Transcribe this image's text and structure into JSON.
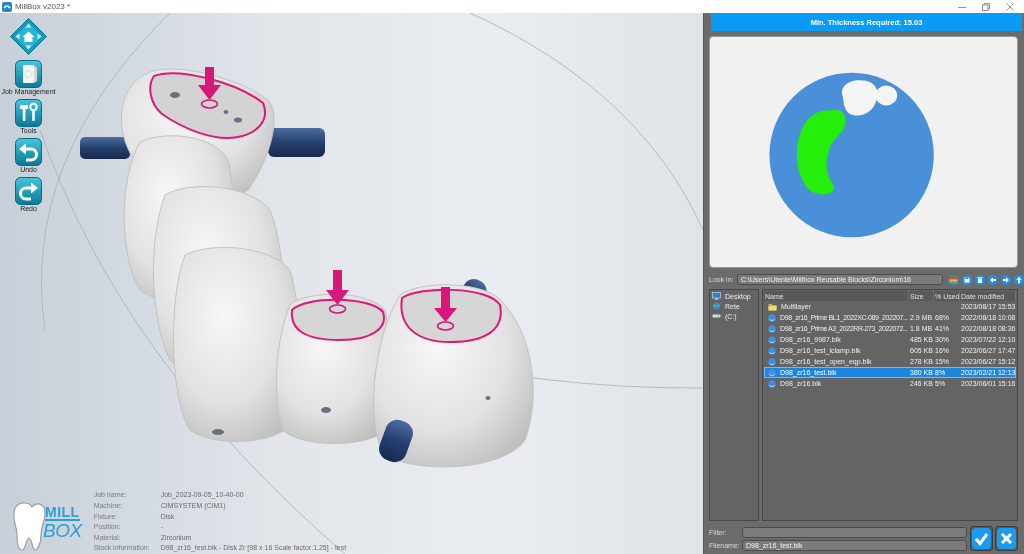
{
  "window": {
    "title": "MillBox v2023 *"
  },
  "toolbar": [
    {
      "kind": "home"
    },
    {
      "kind": "job",
      "label": "Job Management"
    },
    {
      "kind": "tools",
      "label": "Tools"
    },
    {
      "kind": "undo",
      "label": "Undo"
    },
    {
      "kind": "redo",
      "label": "Redo"
    }
  ],
  "logo": {
    "line_1": "MILL",
    "line_2": "BOX"
  },
  "job_info": [
    {
      "label": "Job name:",
      "value": "Job_2023-09-05_10-40-00"
    },
    {
      "label": "Machine:",
      "value": "CIMSYSTEM (CIM1)"
    },
    {
      "label": "Fixture:",
      "value": "Disk"
    },
    {
      "label": "Position:",
      "value": "-"
    },
    {
      "label": "Material:",
      "value": "Zirconium"
    },
    {
      "label": "Stock information:",
      "value": "D98_zr16_test.blk - Disk Zr [98 x 16 Scale factor:1.25] - test"
    }
  ],
  "panel": {
    "banner": "Min. Thickness Required: 15.03",
    "look_in": {
      "label": "Look in:",
      "value": "C:\\Users\\Utente\\Millbox Reusable Blocks\\Zirconium\\16"
    },
    "places": [
      {
        "kind": "desktop",
        "label": "Desktop"
      },
      {
        "kind": "network",
        "label": "Rete"
      },
      {
        "kind": "drive",
        "label": "(C:)"
      }
    ],
    "files": {
      "columns": [
        "Name",
        "Size",
        "% Used",
        "Date modified"
      ],
      "rows": [
        {
          "kind": "folder",
          "name": "Multilayer",
          "date": "2023/08/17 15:53",
          "selected": false
        },
        {
          "kind": "file",
          "name": "D98_zr16_Prime BL1_2022XC-089_202207...",
          "size": "2.9 MB",
          "used": "68%",
          "date": "2022/08/18 10:08",
          "selected": false
        },
        {
          "kind": "file",
          "name": "D98_zr16_Prime A3_2022RR-273_2022072...",
          "size": "1.8 MB",
          "used": "41%",
          "date": "2022/08/18 08:36",
          "selected": false
        },
        {
          "kind": "file",
          "name": "D98_zr16_9987.blk",
          "size": "485 KB",
          "used": "30%",
          "date": "2023/07/22 12:10",
          "selected": false
        },
        {
          "kind": "file",
          "name": "D98_zr16_test_lclamp.blk",
          "size": "605 KB",
          "used": "16%",
          "date": "2023/06/27 17:47",
          "selected": false
        },
        {
          "kind": "file",
          "name": "D98_zr16_test_open_eqp.blk",
          "size": "278 KB",
          "used": "15%",
          "date": "2023/06/27 15:12",
          "selected": false
        },
        {
          "kind": "file",
          "name": "D98_zr16_test.blk",
          "size": "380 KB",
          "used": "8%",
          "date": "2023/02/21 12:13",
          "selected": true
        },
        {
          "kind": "file",
          "name": "D98_zr16.blk",
          "size": "246 KB",
          "used": "5%",
          "date": "2023/06/01 15:16",
          "selected": false
        }
      ]
    },
    "filter": {
      "label": "Filter:"
    },
    "filename": {
      "label": "Filename:",
      "value": "D98_zr16_test.blk"
    }
  }
}
